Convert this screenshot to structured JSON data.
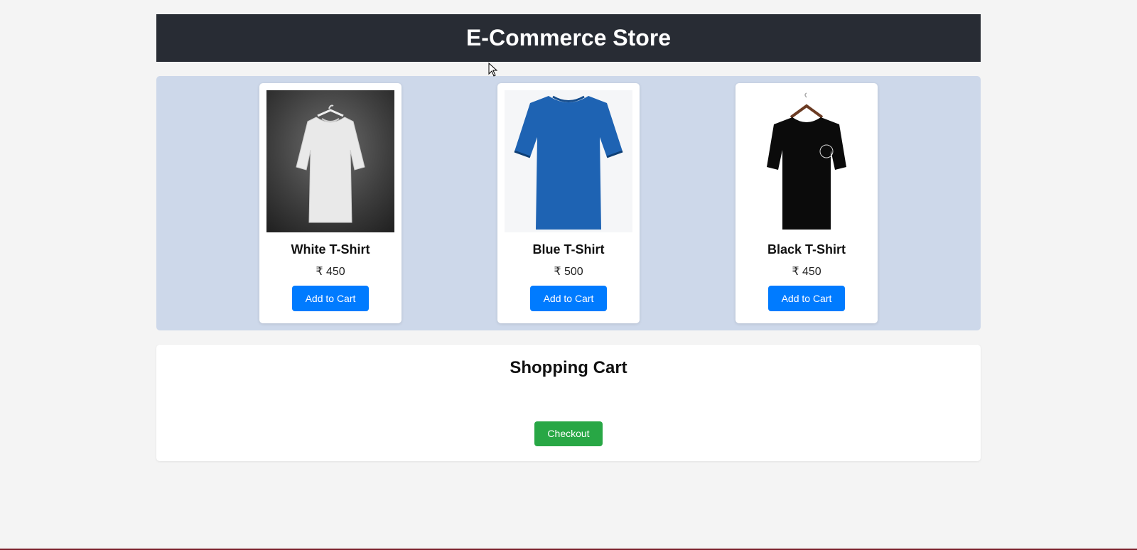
{
  "header": {
    "title": "E-Commerce Store"
  },
  "products": [
    {
      "name": "White T-Shirt",
      "price": "₹ 450",
      "button_label": "Add to Cart",
      "image": "white-tshirt-image",
      "color": "#e9e9e9"
    },
    {
      "name": "Blue T-Shirt",
      "price": "₹ 500",
      "button_label": "Add to Cart",
      "image": "blue-tshirt-image",
      "color": "#1e63b3"
    },
    {
      "name": "Black T-Shirt",
      "price": "₹ 450",
      "button_label": "Add to Cart",
      "image": "black-tshirt-image",
      "color": "#0b0b0b"
    }
  ],
  "cart": {
    "title": "Shopping Cart",
    "checkout_label": "Checkout"
  },
  "colors": {
    "header_bg": "#282c34",
    "products_bg": "#cdd8ea",
    "add_button": "#007bff",
    "checkout_button": "#28a745"
  }
}
